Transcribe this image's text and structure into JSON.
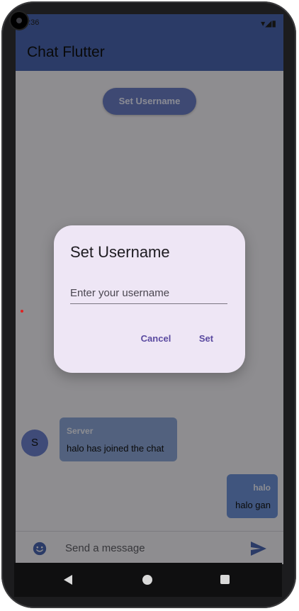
{
  "app": {
    "title": "Chat Flutter",
    "set_username_button": "Set Username"
  },
  "status_bar": {
    "time": "1:36",
    "signal_icons": "▾◢▮"
  },
  "messages": [
    {
      "sender": "Server",
      "avatar_initial": "S",
      "text": "halo has joined the chat",
      "side": "left"
    },
    {
      "sender": "halo",
      "text": "halo gan",
      "side": "right"
    }
  ],
  "composer": {
    "placeholder": "Send a message",
    "emoji_icon": "emoji-icon",
    "send_icon": "send-icon"
  },
  "dialog": {
    "title": "Set Username",
    "input_placeholder": "Enter your username",
    "input_value": "",
    "cancel_label": "Cancel",
    "set_label": "Set"
  },
  "colors": {
    "app_bar": "#4a67b2",
    "primary_button": "#6b7fc6",
    "dialog_background": "#eee6f5",
    "accent_text": "#5a4aa0",
    "server_bubble": "#8ea8da",
    "user_bubble": "#6f93d9"
  }
}
